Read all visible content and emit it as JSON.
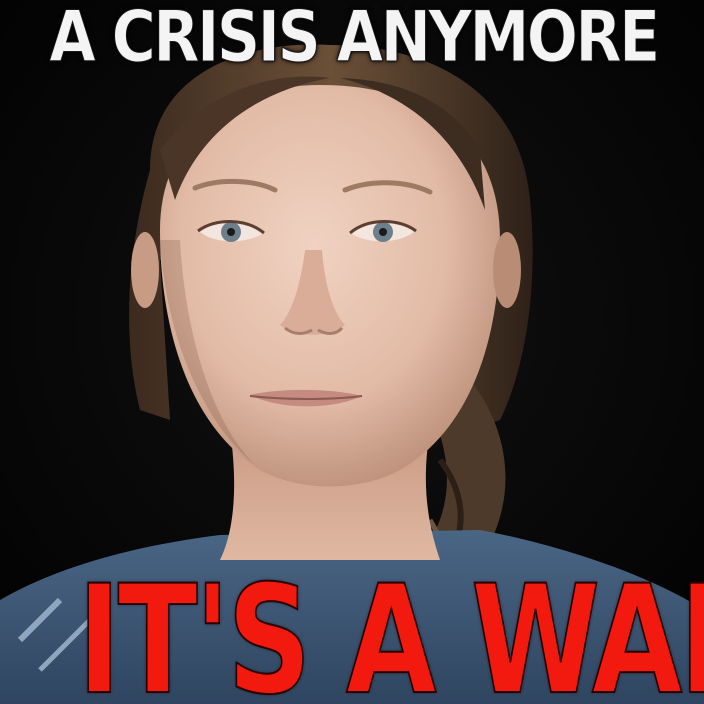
{
  "captions": {
    "top": "A CRISIS ANYMORE",
    "bottom": "IT'S A WAR"
  },
  "colors": {
    "top_text": "#f4f4f4",
    "bottom_text": "#f2190f",
    "background": "#050505",
    "skin": "#e6c2ae",
    "hair": "#5a4230",
    "shirt": "#3f5a78"
  }
}
